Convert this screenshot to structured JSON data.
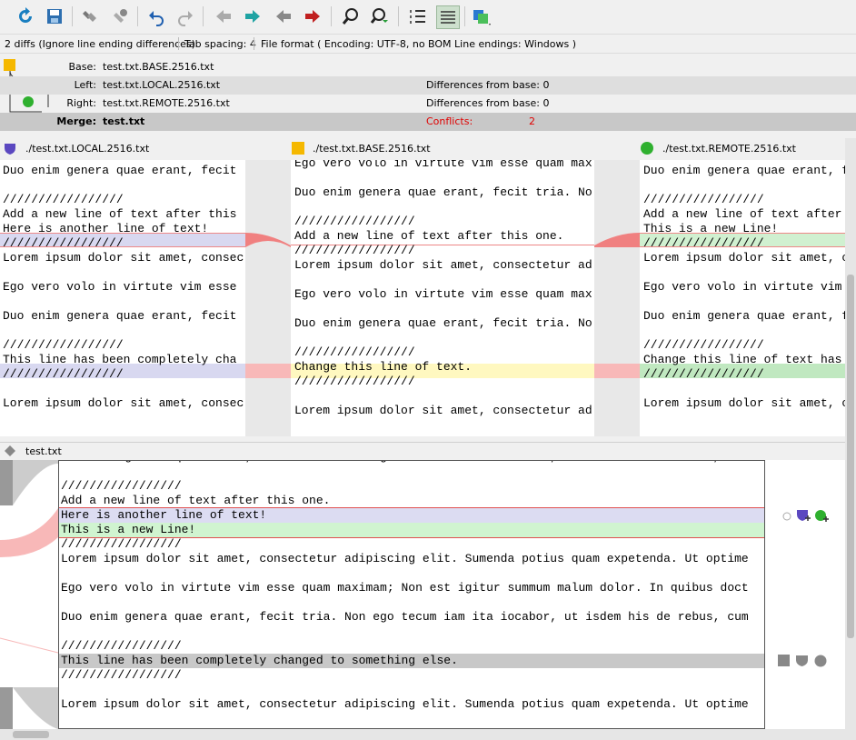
{
  "status": {
    "diffs": "2 diffs (Ignore line ending differences)",
    "tab_spacing": "Tab spacing: 4",
    "file_format": "File format ( Encoding: UTF-8, no BOM  Line endings: Windows )"
  },
  "info": {
    "base_label": "Base:",
    "base_file": "test.txt.BASE.2516.txt",
    "left_label": "Left:",
    "left_file": "test.txt.LOCAL.2516.txt",
    "left_diff": "Differences from base: 0",
    "right_label": "Right:",
    "right_file": "test.txt.REMOTE.2516.txt",
    "right_diff": "Differences from base: 0",
    "merge_label": "Merge:",
    "merge_file": "test.txt",
    "conflicts_label": "Conflicts:",
    "conflicts_count": "2"
  },
  "panes": {
    "local_title": "./test.txt.LOCAL.2516.txt",
    "base_title": "./test.txt.BASE.2516.txt",
    "remote_title": "./test.txt.REMOTE.2516.txt"
  },
  "local_lines": [
    "",
    "Duo enim genera quae erant, fecit",
    "",
    "/////////////////",
    "Add a new line of text after this",
    "Here is another line of text!",
    "/////////////////",
    "Lorem ipsum dolor sit amet, consec",
    "",
    "Ego vero volo in virtute vim esse",
    "",
    "Duo enim genera quae erant, fecit",
    "",
    "/////////////////",
    "This line has been completely cha",
    "/////////////////",
    "",
    "Lorem ipsum dolor sit amet, consec"
  ],
  "base_lines": [
    "Ego vero volo in virtute vim esse quam max",
    "",
    "Duo enim genera quae erant, fecit tria. No",
    "",
    "/////////////////",
    "Add a new line of text after this one.",
    "/////////////////",
    "Lorem ipsum dolor sit amet, consectetur ad",
    "",
    "Ego vero volo in virtute vim esse quam max",
    "",
    "Duo enim genera quae erant, fecit tria. No",
    "",
    "/////////////////",
    "Change this line of text.",
    "/////////////////",
    "",
    "Lorem ipsum dolor sit amet, consectetur ad"
  ],
  "remote_lines": [
    "",
    "Duo enim genera quae erant, fecit",
    "",
    "/////////////////",
    "Add a new line of text after",
    "This is a new Line!",
    "/////////////////",
    "Lorem ipsum dolor sit amet, co",
    "",
    "Ego vero volo in virtute vim e",
    "",
    "Duo enim genera quae erant, f",
    "",
    "/////////////////",
    "Change this line of text has",
    "/////////////////",
    "",
    "Lorem ipsum dolor sit amet, co"
  ],
  "result": {
    "title": "test.txt",
    "lines": [
      "Duo enim genera quae erant, fecit tria. Non ego tecum iam ita iocabor, ut isdem his de rebus, cum",
      "",
      "/////////////////",
      "Add a new line of text after this one.",
      "Here is another line of text!",
      "This is a new Line!",
      "/////////////////",
      "Lorem ipsum dolor sit amet, consectetur adipiscing elit. Sumenda potius quam expetenda. Ut optime",
      "",
      "Ego vero volo in virtute vim esse quam maximam; Non est igitur summum malum dolor. In quibus doct",
      "",
      "Duo enim genera quae erant, fecit tria. Non ego tecum iam ita iocabor, ut isdem his de rebus, cum",
      "",
      "/////////////////",
      "This line has been completely changed to something else.",
      "/////////////////",
      "",
      "Lorem ipsum dolor sit amet, consectetur adipiscing elit. Sumenda potius quam expetenda. Ut optime"
    ]
  },
  "colors": {
    "local_change": "#d8d8f0",
    "remote_change": "#d0f0d0",
    "conflict": "#f8b8b8",
    "base_change": "#fff8c0",
    "conflict_text": "#e00000"
  },
  "icons": [
    "reload-icon",
    "save-icon",
    "mark-resolved-icon",
    "mark-resolved-all-icon",
    "undo-icon",
    "redo-icon",
    "prev-diff-icon",
    "next-diff-icon",
    "prev-conflict-icon",
    "next-conflict-icon",
    "find-icon",
    "find-next-icon",
    "line-numbers-icon",
    "whitespace-icon",
    "layout-icon"
  ]
}
